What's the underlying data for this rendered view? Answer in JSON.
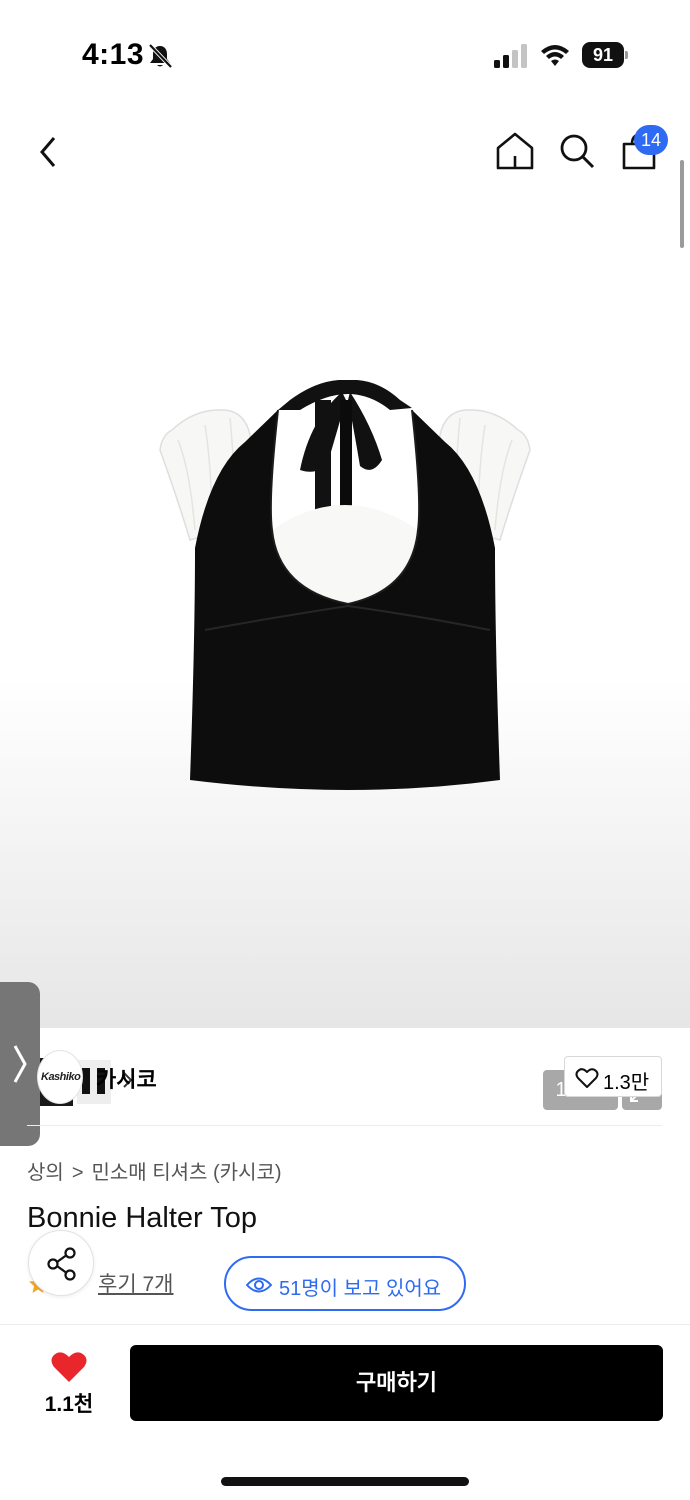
{
  "status_bar": {
    "time": "4:13",
    "battery": "91"
  },
  "nav": {
    "cart_count": "14"
  },
  "gallery": {
    "page_indicator": "1 / 17"
  },
  "brand": {
    "logo_text": "Kashiko",
    "name": "카시코",
    "likes": "1.3만"
  },
  "product": {
    "breadcrumb": [
      "상의",
      "민소매 티셔츠 (카시코)"
    ],
    "breadcrumb_separator": ">",
    "title": "Bonnie Halter Top",
    "reviews": "후기 7개",
    "viewers": "51명이 보고 있어요"
  },
  "bottom_bar": {
    "wishlist_count": "1.1천",
    "buy_label": "구매하기"
  },
  "colors": {
    "accent": "#2f6bf2",
    "wishlist_red": "#e8262b",
    "buy_button": "#000000"
  },
  "icons": [
    "bell-slash-icon",
    "signal-icon",
    "wifi-icon",
    "battery-icon",
    "back-arrow-icon",
    "home-icon",
    "search-icon",
    "shopping-bag-icon",
    "expand-icon",
    "chevron-right-icon",
    "heart-outline-icon",
    "share-icon",
    "star-icon",
    "eye-icon",
    "heart-filled-icon"
  ]
}
